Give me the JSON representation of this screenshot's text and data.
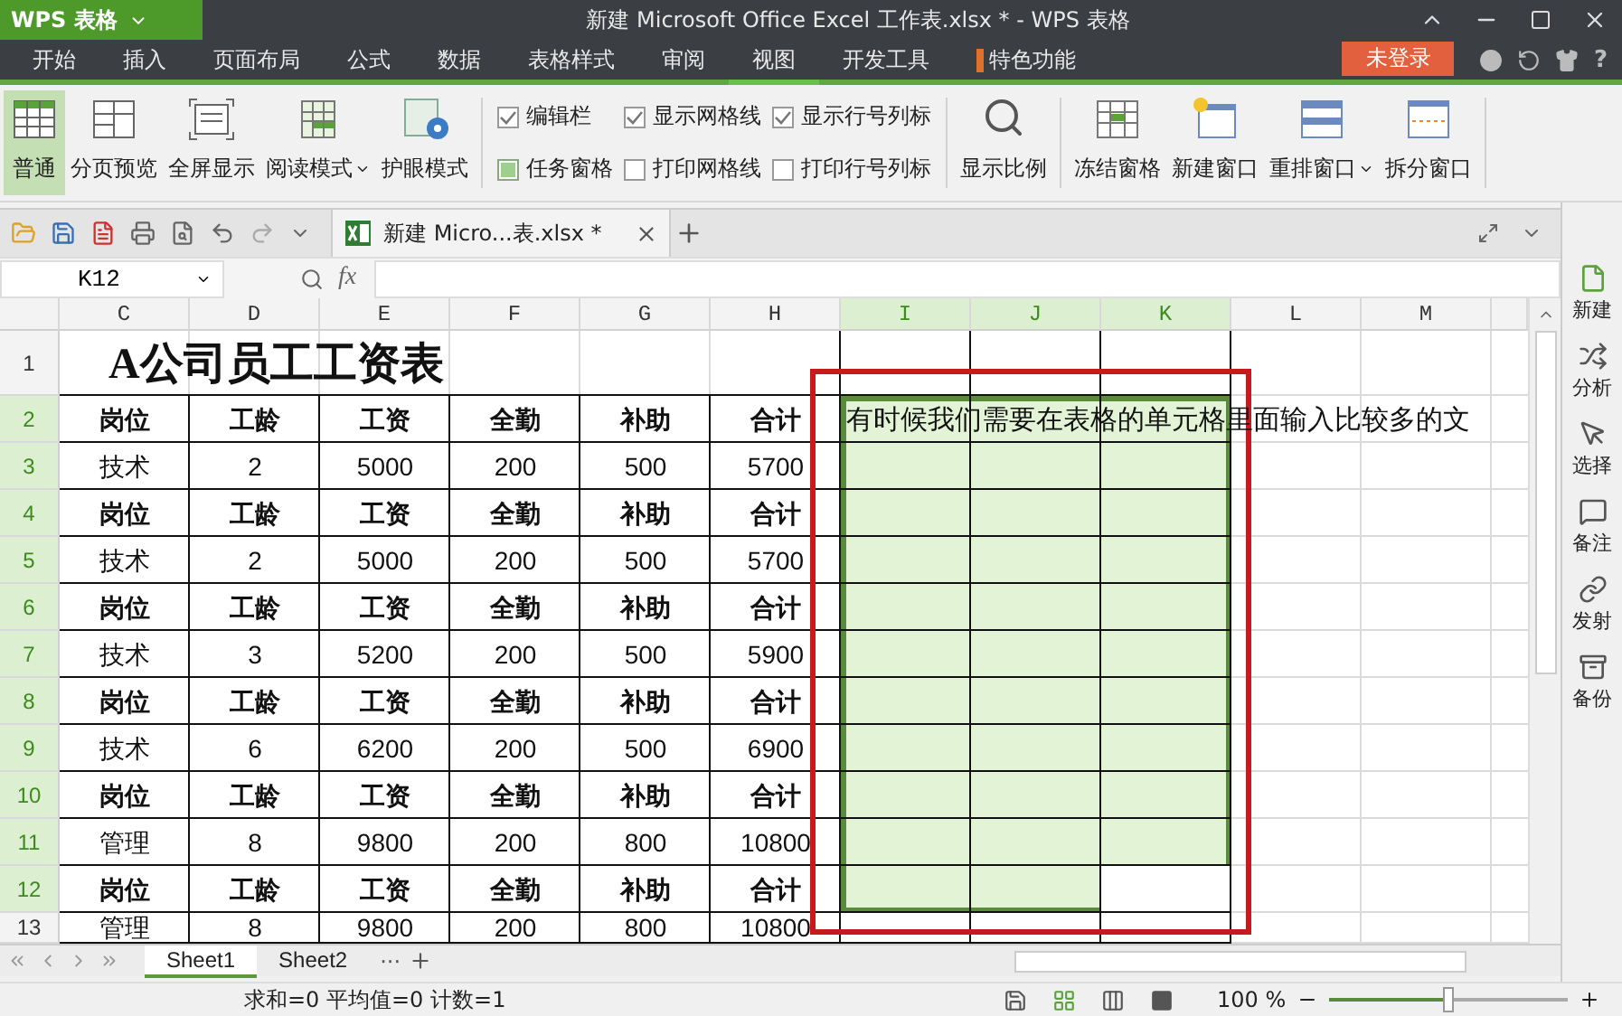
{
  "title_bar": {
    "app_button": "WPS 表格",
    "title": "新建 Microsoft Office Excel 工作表.xlsx * - WPS 表格"
  },
  "menu": [
    {
      "label": "开始",
      "selected": false
    },
    {
      "label": "插入",
      "selected": false
    },
    {
      "label": "页面布局",
      "selected": false
    },
    {
      "label": "公式",
      "selected": false
    },
    {
      "label": "数据",
      "selected": false
    },
    {
      "label": "表格样式",
      "selected": false
    },
    {
      "label": "审阅",
      "selected": false
    },
    {
      "label": "视图",
      "selected": true
    },
    {
      "label": "开发工具",
      "selected": false
    },
    {
      "label": "特色功能",
      "selected": false
    }
  ],
  "login_button": "未登录",
  "help": "?",
  "ribbon": {
    "view_buttons": [
      {
        "label": "普通",
        "selected": true,
        "dropdown": false
      },
      {
        "label": "分页预览",
        "selected": false,
        "dropdown": false
      },
      {
        "label": "全屏显示",
        "selected": false,
        "dropdown": false
      },
      {
        "label": "阅读模式",
        "selected": false,
        "dropdown": true
      },
      {
        "label": "护眼模式",
        "selected": false,
        "dropdown": false
      }
    ],
    "checkboxes": [
      {
        "label": "编辑栏",
        "kind": "tick",
        "checked": true
      },
      {
        "label": "任务窗格",
        "kind": "fill",
        "checked": true
      },
      {
        "label": "显示网格线",
        "kind": "tick",
        "checked": true
      },
      {
        "label": "打印网格线",
        "kind": "tick",
        "checked": false
      },
      {
        "label": "显示行号列标",
        "kind": "tick",
        "checked": true
      },
      {
        "label": "打印行号列标",
        "kind": "tick",
        "checked": false
      }
    ],
    "zoom_button": "显示比例",
    "window_buttons": [
      {
        "label": "冻结窗格",
        "dropdown": false
      },
      {
        "label": "新建窗口",
        "dropdown": false
      },
      {
        "label": "重排窗口",
        "dropdown": true
      },
      {
        "label": "拆分窗口",
        "dropdown": false
      }
    ]
  },
  "document_tab": "新建 Micro...表.xlsx *",
  "name_box": "K12",
  "function_label": "fx",
  "columns": [
    {
      "label": "C",
      "selected": false
    },
    {
      "label": "D",
      "selected": false
    },
    {
      "label": "E",
      "selected": false
    },
    {
      "label": "F",
      "selected": false
    },
    {
      "label": "G",
      "selected": false
    },
    {
      "label": "H",
      "selected": false
    },
    {
      "label": "I",
      "selected": true
    },
    {
      "label": "J",
      "selected": true
    },
    {
      "label": "K",
      "selected": true
    },
    {
      "label": "L",
      "selected": false
    },
    {
      "label": "M",
      "selected": false
    }
  ],
  "rows": [
    {
      "number": "1",
      "kind": "title",
      "selected": false,
      "cells": [
        "A公司员工工资表"
      ]
    },
    {
      "number": "2",
      "kind": "header",
      "selected": true,
      "cells": [
        "岗位",
        "工龄",
        "工资",
        "全勤",
        "补助",
        "合计"
      ],
      "note": "有时候我们需要在表格的单元格里面输入比较多的文"
    },
    {
      "number": "3",
      "kind": "data",
      "selected": true,
      "cells": [
        "技术",
        "2",
        "5000",
        "200",
        "500",
        "5700"
      ]
    },
    {
      "number": "4",
      "kind": "header",
      "selected": true,
      "cells": [
        "岗位",
        "工龄",
        "工资",
        "全勤",
        "补助",
        "合计"
      ]
    },
    {
      "number": "5",
      "kind": "data",
      "selected": true,
      "cells": [
        "技术",
        "2",
        "5000",
        "200",
        "500",
        "5700"
      ]
    },
    {
      "number": "6",
      "kind": "header",
      "selected": true,
      "cells": [
        "岗位",
        "工龄",
        "工资",
        "全勤",
        "补助",
        "合计"
      ]
    },
    {
      "number": "7",
      "kind": "data",
      "selected": true,
      "cells": [
        "技术",
        "3",
        "5200",
        "200",
        "500",
        "5900"
      ]
    },
    {
      "number": "8",
      "kind": "header",
      "selected": true,
      "cells": [
        "岗位",
        "工龄",
        "工资",
        "全勤",
        "补助",
        "合计"
      ]
    },
    {
      "number": "9",
      "kind": "data",
      "selected": true,
      "cells": [
        "技术",
        "6",
        "6200",
        "200",
        "500",
        "6900"
      ]
    },
    {
      "number": "10",
      "kind": "header",
      "selected": true,
      "cells": [
        "岗位",
        "工龄",
        "工资",
        "全勤",
        "补助",
        "合计"
      ]
    },
    {
      "number": "11",
      "kind": "data",
      "selected": true,
      "cells": [
        "管理",
        "8",
        "9800",
        "200",
        "800",
        "10800"
      ]
    },
    {
      "number": "12",
      "kind": "header",
      "selected": true,
      "cells": [
        "岗位",
        "工龄",
        "工资",
        "全勤",
        "补助",
        "合计"
      ]
    },
    {
      "number": "13",
      "kind": "data",
      "selected": false,
      "cells": [
        "管理",
        "8",
        "9800",
        "200",
        "800",
        "10800"
      ]
    }
  ],
  "sidebar": [
    "新建",
    "分析",
    "选择",
    "备注",
    "发射",
    "备份"
  ],
  "sheet_tabs": [
    {
      "label": "Sheet1",
      "selected": true
    },
    {
      "label": "Sheet2",
      "selected": false
    }
  ],
  "more_sheets": "···",
  "status_bar": {
    "summary": "求和=0 平均值=0 计数=1",
    "zoom": "100 %",
    "zoom_level": {
      "level": 0.5
    }
  }
}
